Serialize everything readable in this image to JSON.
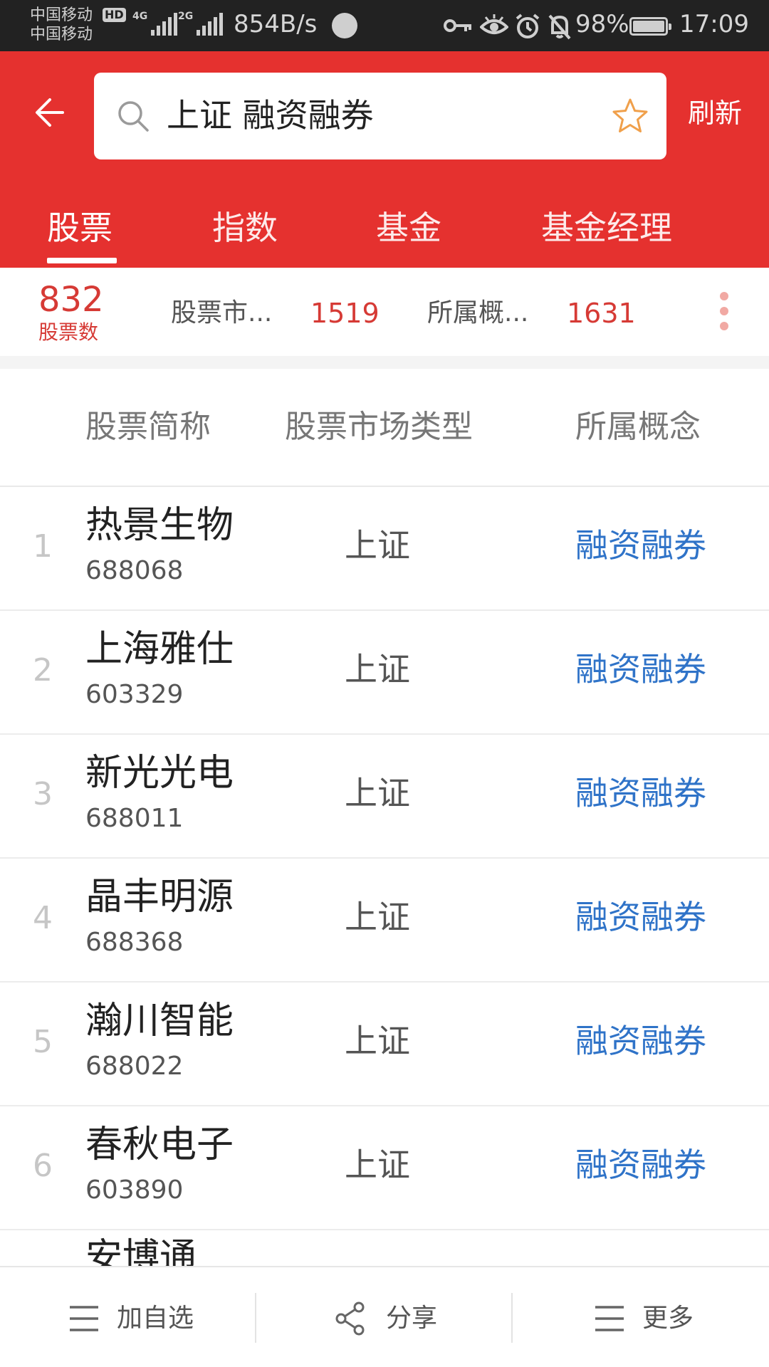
{
  "status_bar": {
    "carrier1": "中国移动",
    "carrier2": "中国移动",
    "hd": "HD",
    "net_tag1": "4G",
    "net_tag2": "2G",
    "net_speed": "854B/s",
    "battery": "98%",
    "time": "17:09",
    "icons": [
      "key-icon",
      "eye-icon",
      "alarm-icon",
      "bell-off-icon",
      "battery-icon"
    ]
  },
  "header": {
    "search_query": "上证 融资融券",
    "refresh": "刷新",
    "accent": "#e5312f"
  },
  "tabs": [
    {
      "label": "股票",
      "active": true
    },
    {
      "label": "指数",
      "active": false
    },
    {
      "label": "基金",
      "active": false
    },
    {
      "label": "基金经理",
      "active": false
    }
  ],
  "summary": {
    "count": "832",
    "count_label": "股票数",
    "filters": [
      {
        "label": "股票市...",
        "count": "1519"
      },
      {
        "label": "所属概...",
        "count": "1631"
      }
    ]
  },
  "table": {
    "headers": [
      "股票简称",
      "股票市场类型",
      "所属概念"
    ],
    "rows": [
      {
        "rank": "1",
        "name": "热景生物",
        "code": "688068",
        "market": "上证",
        "concept": "融资融券"
      },
      {
        "rank": "2",
        "name": "上海雅仕",
        "code": "603329",
        "market": "上证",
        "concept": "融资融券"
      },
      {
        "rank": "3",
        "name": "新光光电",
        "code": "688011",
        "market": "上证",
        "concept": "融资融券"
      },
      {
        "rank": "4",
        "name": "晶丰明源",
        "code": "688368",
        "market": "上证",
        "concept": "融资融券"
      },
      {
        "rank": "5",
        "name": "瀚川智能",
        "code": "688022",
        "market": "上证",
        "concept": "融资融券"
      },
      {
        "rank": "6",
        "name": "春秋电子",
        "code": "603890",
        "market": "上证",
        "concept": "融资融券"
      }
    ],
    "partial_row_name": "安博通"
  },
  "bottom_bar": {
    "add_watch": "加自选",
    "share": "分享",
    "more": "更多"
  }
}
